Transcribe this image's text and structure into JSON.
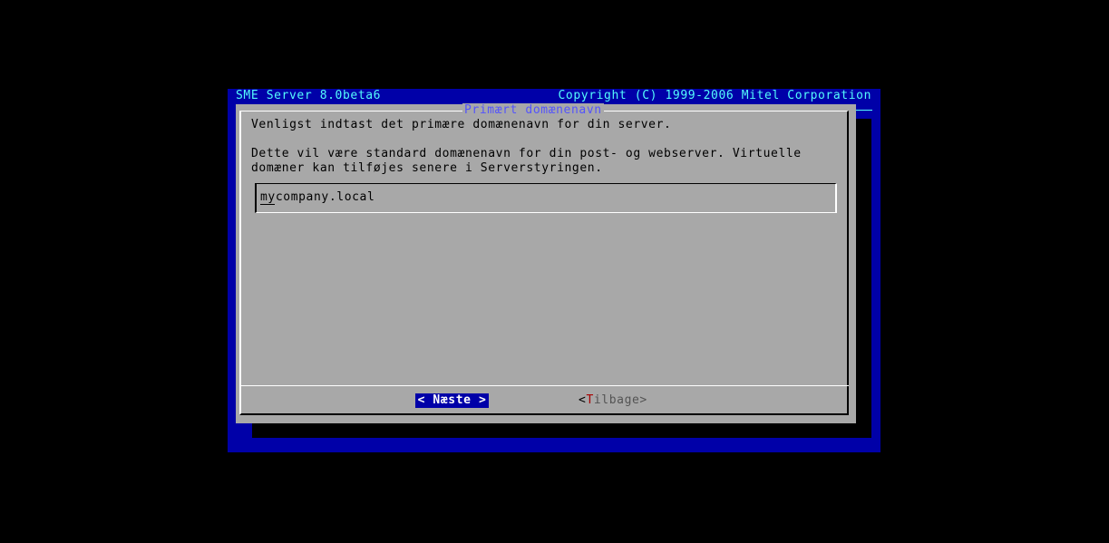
{
  "backtitle": {
    "left": "SME Server 8.0beta6",
    "right": "Copyright (C) 1999-2006 Mitel Corporation"
  },
  "dialog": {
    "title": "Primært domænenavn",
    "prompt_lines": [
      "Venligst indtast det primære domænenavn for din server.",
      "Dette vil være standard domænenavn for din post- og webserver. Virtuelle",
      "domæner kan tilføjes senere i Serverstyringen."
    ],
    "input_value": "mycompany.local",
    "buttons": {
      "next_label": "< Næste >",
      "back_open": "<",
      "back_hotkey": "T",
      "back_rest": "ilbage>"
    }
  },
  "colors": {
    "screen_background": "#0000a8",
    "dialog_background": "#a8a8a8",
    "title_text": "#5454fc",
    "backtitle_text": "#54fcfc",
    "selected_button": "#0000a8",
    "hotkey": "#a80000"
  }
}
